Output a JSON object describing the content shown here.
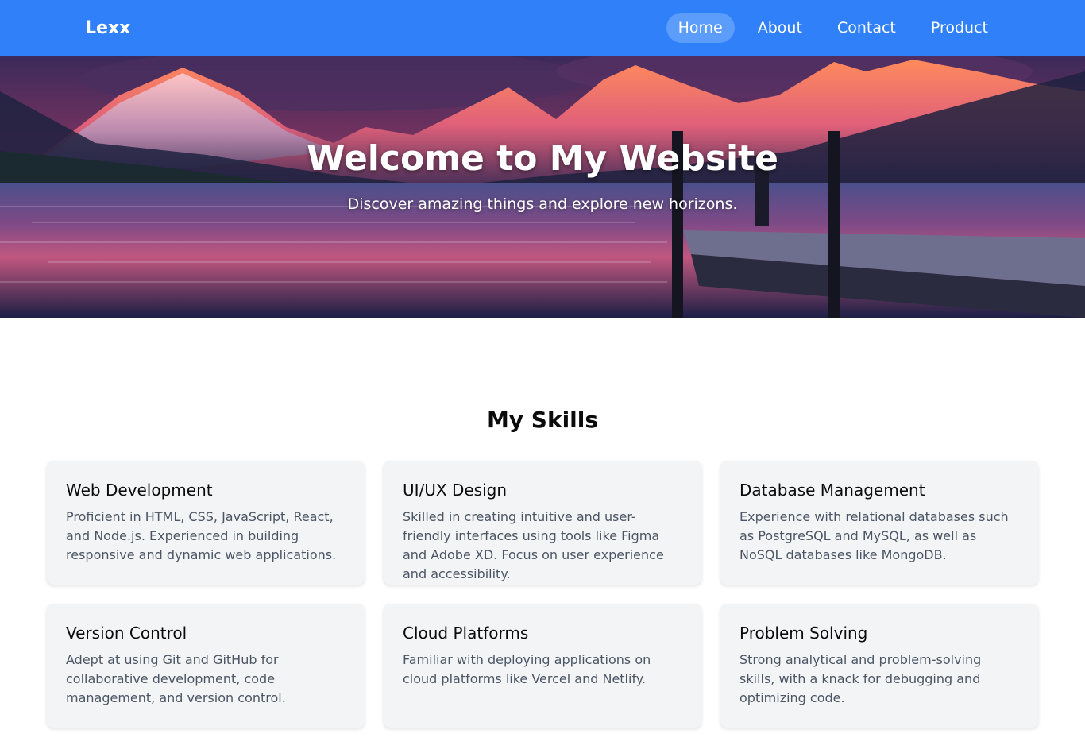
{
  "nav": {
    "brand": "Lexx",
    "links": [
      {
        "label": "Home",
        "active": true
      },
      {
        "label": "About",
        "active": false
      },
      {
        "label": "Contact",
        "active": false
      },
      {
        "label": "Product",
        "active": false
      }
    ]
  },
  "hero": {
    "title": "Welcome to My Website",
    "subtitle": "Discover amazing things and explore new horizons."
  },
  "skills": {
    "heading": "My Skills",
    "cards": [
      {
        "title": "Web Development",
        "description": "Proficient in HTML, CSS, JavaScript, React, and Node.js. Experienced in building responsive and dynamic web applications."
      },
      {
        "title": "UI/UX Design",
        "description": "Skilled in creating intuitive and user-friendly interfaces using tools like Figma and Adobe XD. Focus on user experience and accessibility."
      },
      {
        "title": "Database Management",
        "description": "Experience with relational databases such as PostgreSQL and MySQL, as well as NoSQL databases like MongoDB."
      },
      {
        "title": "Version Control",
        "description": "Adept at using Git and GitHub for collaborative development, code management, and version control."
      },
      {
        "title": "Cloud Platforms",
        "description": "Familiar with deploying applications on cloud platforms like Vercel and Netlify."
      },
      {
        "title": "Problem Solving",
        "description": "Strong analytical and problem-solving skills, with a knack for debugging and optimizing code."
      }
    ]
  },
  "colors": {
    "navbar": "#2f80f9",
    "card_bg": "#f3f4f6",
    "card_text": "#4b5563"
  }
}
